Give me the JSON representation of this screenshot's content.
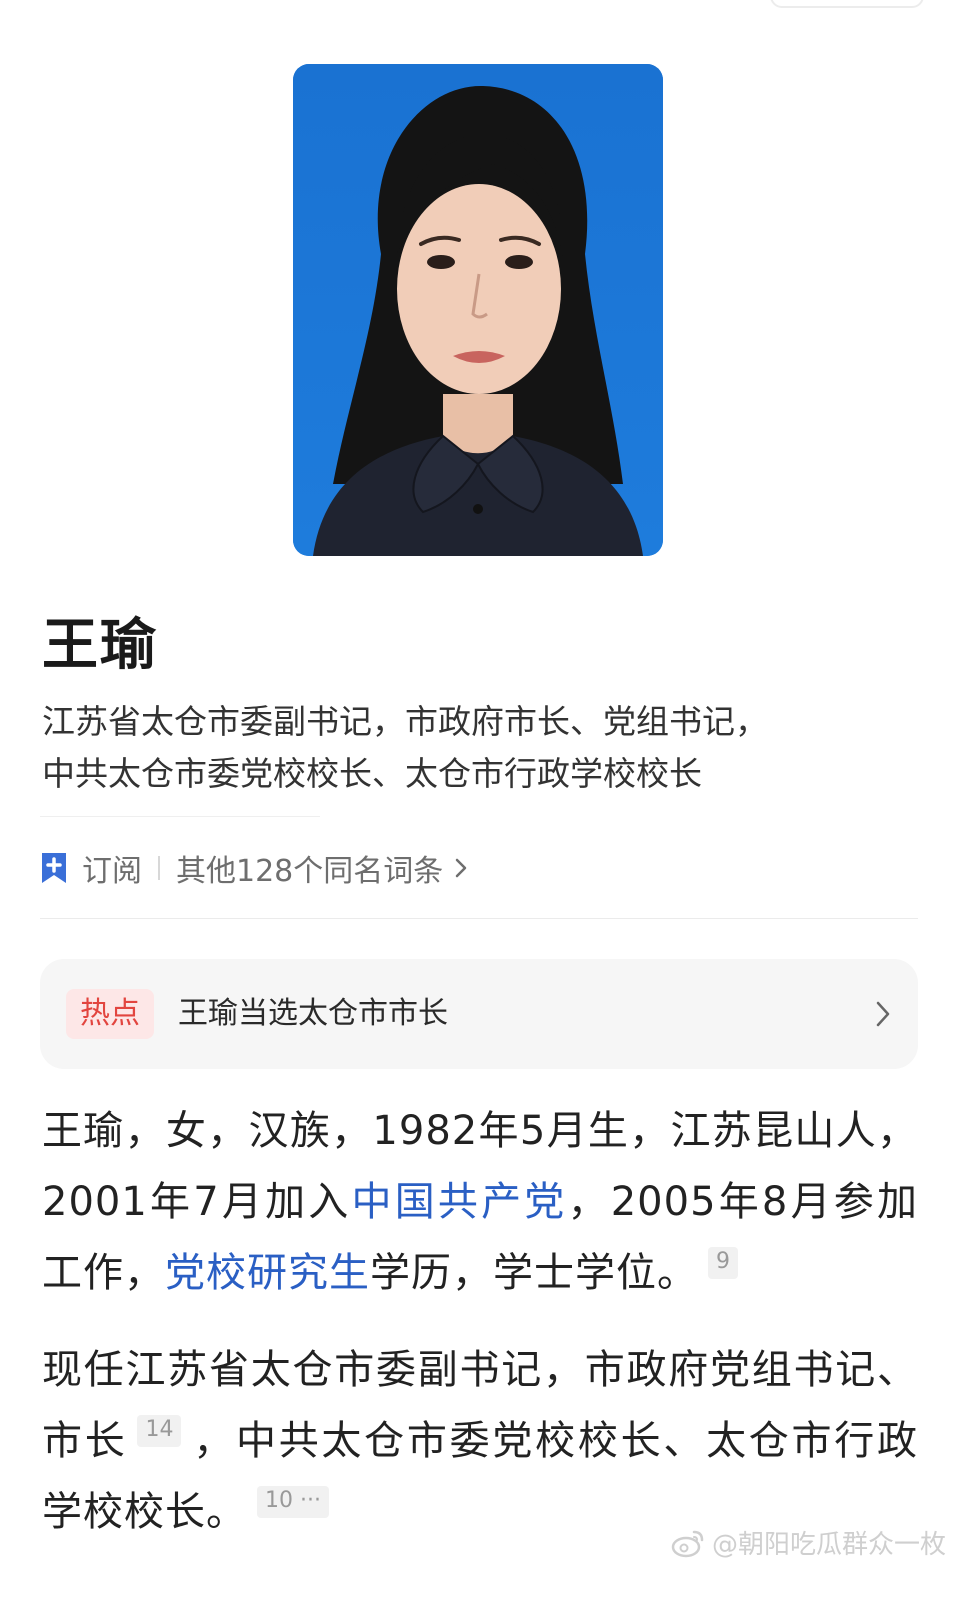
{
  "profile": {
    "photo_alt": "portrait-photo",
    "name": "王瑜",
    "subtitle_lines": [
      "江苏省太仓市委副书记，市政府市长、党组书记，",
      "中共太仓市委党校校长、太仓市行政学校校长"
    ]
  },
  "meta": {
    "subscribe_label": "订阅",
    "other_entries_label": "其他128个同名词条"
  },
  "hot": {
    "badge": "热点",
    "text": "王瑜当选太仓市市长"
  },
  "body": {
    "p1": {
      "t1": "王瑜，女，汉族，1982年5月生，江苏昆山人，2001年7月加入",
      "link1": "中国共产党",
      "t2": "，2005年8月参加工作，",
      "link2": "党校研究生",
      "t3": "学历，学士学位。",
      "ref": "9"
    },
    "p2": {
      "t1": "现任江苏省太仓市委副书记，市政府党组书记、市长",
      "ref1": "14",
      "t2": "，中共太仓市委党校校长、太仓市行政学校校长。",
      "ref2": "10 ···"
    }
  },
  "watermark": "@朝阳吃瓜群众一枚",
  "colors": {
    "link": "#2a5fc4",
    "hot_badge_text": "#e2453f",
    "hot_badge_bg": "#fde7e7",
    "photo_bg": "#1f77d4",
    "bookmark_icon": "#3a6fd8"
  },
  "icons": [
    "bookmark-plus-icon",
    "chevron-right-icon",
    "weibo-icon"
  ]
}
